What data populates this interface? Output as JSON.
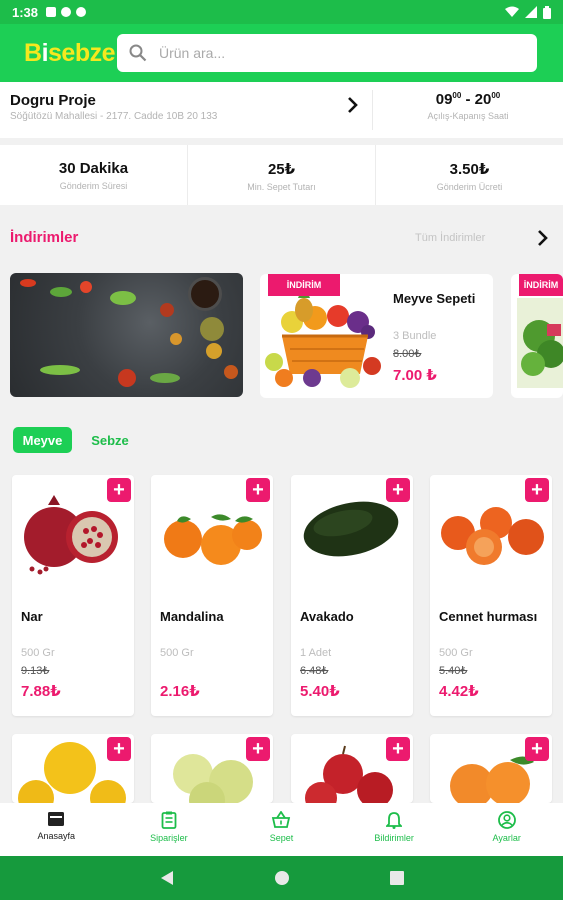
{
  "status": {
    "time": "1:38"
  },
  "app": {
    "logo_main": "B",
    "logo_accent": "i",
    "logo_rest": "sebze"
  },
  "search": {
    "placeholder": "Ürün ara..."
  },
  "store": {
    "name": "Dogru Proje",
    "address": "Söğütözü Mahallesi - 2177. Cadde 10B 20 133",
    "open": "09",
    "open_min": "00",
    "sep": " - ",
    "close": "20",
    "close_min": "00",
    "hours_label": "Açılış-Kapanış Saati"
  },
  "info": [
    {
      "value": "30 Dakika",
      "label": "Gönderim Süresi"
    },
    {
      "value": "25₺",
      "label": "Min. Sepet Tutarı"
    },
    {
      "value": "3.50₺",
      "label": "Gönderim Ücreti"
    }
  ],
  "discounts": {
    "title": "İndirimler",
    "see_all": "Tüm İndirimler",
    "cards": [
      {
        "ribbon": "İNDİRİM",
        "name": "Meyve Sepeti",
        "unit": "3 Bundle",
        "old_price": "8.00₺",
        "new_price": "7.00 ₺"
      },
      {
        "ribbon": "İNDİRİM"
      }
    ]
  },
  "tabs": [
    {
      "label": "Meyve"
    },
    {
      "label": "Sebze"
    }
  ],
  "products": [
    {
      "name": "Nar",
      "unit": "500 Gr",
      "old_price": "9.13₺",
      "new_price": "7.88₺"
    },
    {
      "name": "Mandalina",
      "unit": "500 Gr",
      "old_price": "",
      "new_price": "2.16₺"
    },
    {
      "name": "Avakado",
      "unit": "1 Adet",
      "old_price": "6.48₺",
      "new_price": "5.40₺"
    },
    {
      "name": "Cennet hurması",
      "unit": "500 Gr",
      "old_price": "5.40₺",
      "new_price": "4.42₺"
    }
  ],
  "add_label": "+",
  "bottom_nav": [
    {
      "label": "Anasayfa"
    },
    {
      "label": "Siparişler"
    },
    {
      "label": "Sepet"
    },
    {
      "label": "Bildirimler"
    },
    {
      "label": "Ayarlar"
    }
  ],
  "colors": {
    "primary": "#1dcf55",
    "accent": "#ec1a6e",
    "logo_yellow": "#f5e81e"
  }
}
